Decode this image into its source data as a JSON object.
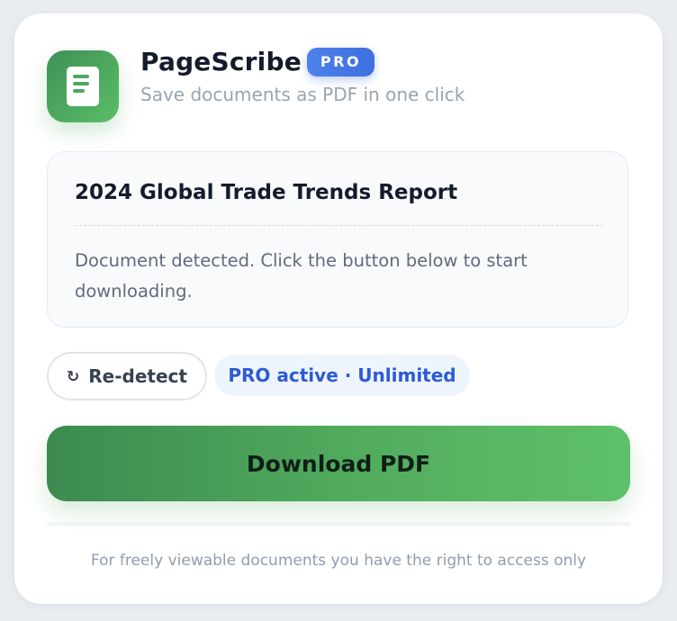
{
  "header": {
    "app_title": "PageScribe",
    "badge": "PRO",
    "subtitle": "Save documents as PDF in one click",
    "icon": "document-icon"
  },
  "document": {
    "title": "2024 Global Trade Trends Report",
    "status": "Document detected. Click the button below to start downloading."
  },
  "actions": {
    "redetect_icon": "↻",
    "redetect_label": "Re-detect",
    "pro_status": "PRO active · Unlimited",
    "download_label": "Download PDF"
  },
  "footer": {
    "disclaimer": "For freely viewable documents you have the right to access only"
  },
  "colors": {
    "accent_green": "#52ad5e",
    "accent_blue": "#2c5ad6",
    "badge_blue": "#4c80ea"
  }
}
